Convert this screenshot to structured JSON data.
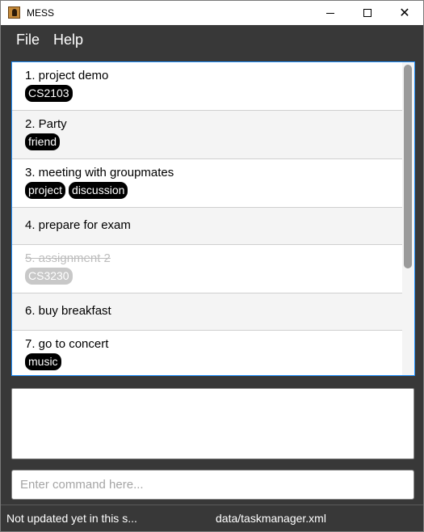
{
  "window": {
    "title": "MESS"
  },
  "menu": {
    "file": "File",
    "help": "Help"
  },
  "tasks": [
    {
      "title": "1. project demo",
      "tags": [
        "CS2103"
      ],
      "done": false
    },
    {
      "title": "2. Party",
      "tags": [
        "friend"
      ],
      "done": false
    },
    {
      "title": "3. meeting with groupmates",
      "tags": [
        "project",
        "discussion"
      ],
      "done": false
    },
    {
      "title": "4. prepare for exam",
      "tags": [],
      "done": false
    },
    {
      "title": "5. assignment 2",
      "tags": [
        "CS3230"
      ],
      "done": true
    },
    {
      "title": "6. buy breakfast",
      "tags": [],
      "done": false
    },
    {
      "title": "7. go to concert",
      "tags": [
        "music"
      ],
      "done": false
    }
  ],
  "command": {
    "placeholder": "Enter command here...",
    "value": ""
  },
  "result": {
    "text": ""
  },
  "status": {
    "sync": "Not updated yet in this s...",
    "file": "data/taskmanager.xml"
  }
}
